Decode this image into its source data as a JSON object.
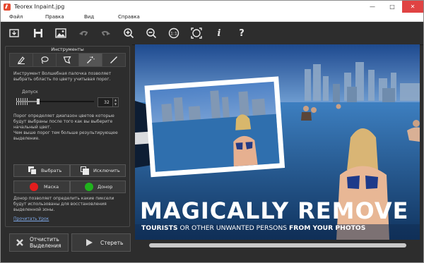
{
  "window": {
    "title": "Teorex Inpaint.jpg"
  },
  "menu": {
    "file": "Файл",
    "edit": "Правка",
    "view": "Вид",
    "help": "Справка"
  },
  "toolbar": {
    "icons": [
      "open-icon",
      "save-icon",
      "image-icon",
      "undo-icon",
      "redo-icon",
      "zoom-in-icon",
      "zoom-out-icon",
      "actual-size-icon",
      "fit-icon",
      "info-icon",
      "help-icon"
    ],
    "info_glyph": "i",
    "help_glyph": "?"
  },
  "panel": {
    "title": "Инструменты",
    "tool_description": "Инструмент Волшебная палочка позволяет выбрать область по цвету учитывая порог.",
    "tolerance_label": "Допуск",
    "tolerance_value": "32",
    "tolerance_fraction": 0.28,
    "threshold_help_1": "Порог определяет диапазон цветов которые будут выбраны после того как вы выберите начальный цвет.",
    "threshold_help_2": "Чем выше порог тем больше результирующее выделение.",
    "select_label": "Выбрать",
    "exclude_label": "Исключить",
    "mask_label": "Маска",
    "donor_label": "Донор",
    "donor_help": "Донор позволяет определить какие пиксели будут использованы для восстановления выделенной зоны.",
    "lesson_link": "Прочитать Урок",
    "clear_label_1": "Отчистить",
    "clear_label_2": "Выделения",
    "erase_label": "Стереть"
  },
  "colors": {
    "mask": "#e41d1d",
    "donor": "#20b21d",
    "accent": "#7ea8e8"
  },
  "canvas": {
    "headline": "MAGICALLY REMOVE",
    "sub_a": "TOURISTS",
    "sub_b": " OR OTHER UNWANTED PERSONS ",
    "sub_c": "FROM YOUR PHOTOS"
  }
}
